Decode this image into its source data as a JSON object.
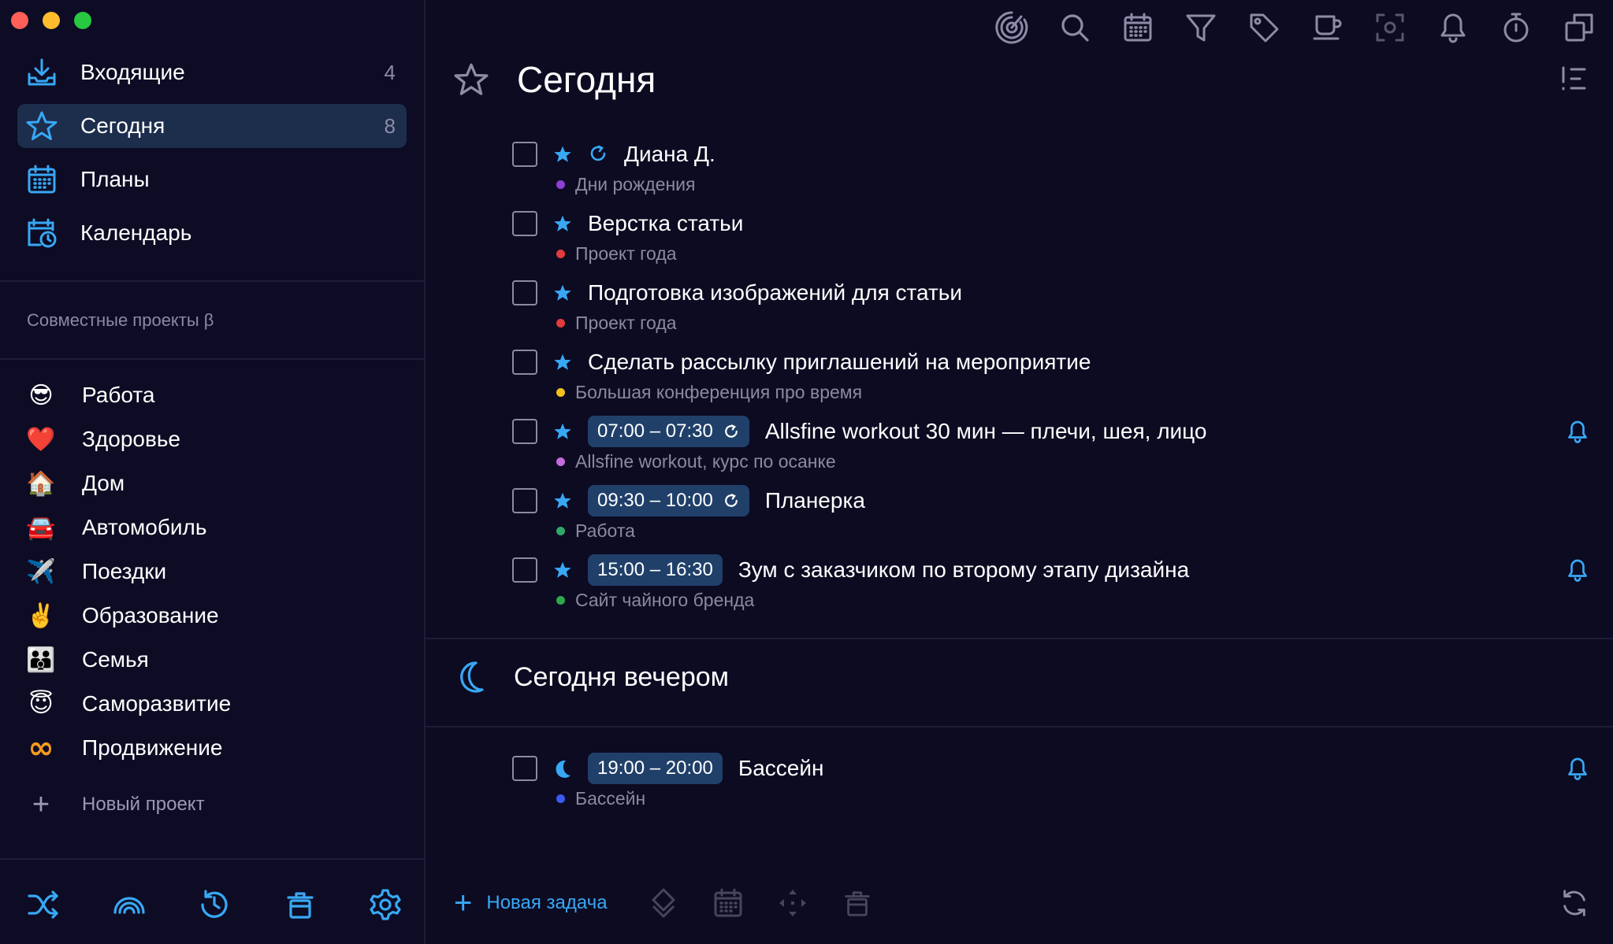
{
  "colors": {
    "accent": "#38a8f5",
    "background": "#0c0b22",
    "active_row": "#1d2d4c",
    "time_badge": "#20406a",
    "muted_text": "#8a8aa2"
  },
  "sidebar": {
    "nav": [
      {
        "label": "Входящие",
        "count": "4",
        "icon": "inbox-icon"
      },
      {
        "label": "Сегодня",
        "count": "8",
        "icon": "star-icon"
      },
      {
        "label": "Планы",
        "count": "",
        "icon": "calendar-grid-icon"
      },
      {
        "label": "Календарь",
        "count": "",
        "icon": "calendar-clock-icon"
      }
    ],
    "shared_title": "Совместные проекты β",
    "projects": [
      {
        "emoji": "😎",
        "label": "Работа"
      },
      {
        "emoji": "❤️",
        "label": "Здоровье"
      },
      {
        "emoji": "🏠",
        "label": "Дом"
      },
      {
        "emoji": "🚘",
        "label": "Автомобиль"
      },
      {
        "emoji": "✈️",
        "label": "Поездки"
      },
      {
        "emoji": "✌️",
        "label": "Образование"
      },
      {
        "emoji": "👪",
        "label": "Семья"
      },
      {
        "emoji": "😇",
        "label": "Саморазвитие"
      },
      {
        "emoji": "∞",
        "label": "Продвижение"
      }
    ],
    "new_project": "Новый проект",
    "bottom_tools": [
      "shuffle-icon",
      "rainbow-icon",
      "history-icon",
      "trash-icon",
      "settings-icon"
    ]
  },
  "toolbar": [
    "focus-icon",
    "search-icon",
    "calendar-icon",
    "filter-icon",
    "tag-icon",
    "coffee-icon",
    "screenshot-icon",
    "bell-icon",
    "timer-icon",
    "windows-icon"
  ],
  "main": {
    "title": "Сегодня",
    "tasks": [
      {
        "title": "Диана Д.",
        "time": "",
        "recurring": true,
        "recurring_in_badge": false,
        "project": "Дни рождения",
        "dot": "#8e3fd6",
        "bell": false
      },
      {
        "title": "Верстка статьи",
        "time": "",
        "recurring": false,
        "recurring_in_badge": false,
        "project": "Проект года",
        "dot": "#e23b3b",
        "bell": false
      },
      {
        "title": "Подготовка изображений для статьи",
        "time": "",
        "recurring": false,
        "recurring_in_badge": false,
        "project": "Проект года",
        "dot": "#e23b3b",
        "bell": false
      },
      {
        "title": "Сделать рассылку приглашений на мероприятие",
        "time": "",
        "recurring": false,
        "recurring_in_badge": false,
        "project": "Большая конференция про время",
        "dot": "#f2c21b",
        "bell": false
      },
      {
        "title": "Allsfine workout 30 мин — плечи, шея, лицо",
        "time": "07:00 – 07:30",
        "recurring": false,
        "recurring_in_badge": true,
        "project": "Allsfine workout, курс по осанке",
        "dot": "#c46adc",
        "bell": true
      },
      {
        "title": "Планерка",
        "time": "09:30 – 10:00",
        "recurring": false,
        "recurring_in_badge": true,
        "project": "Работа",
        "dot": "#2fa86a",
        "bell": false
      },
      {
        "title": "Зум с заказчиком по второму этапу дизайна",
        "time": "15:00 – 16:30",
        "recurring": false,
        "recurring_in_badge": false,
        "project": "Сайт чайного бренда",
        "dot": "#2fa84a",
        "bell": true
      }
    ],
    "evening": {
      "title": "Сегодня вечером",
      "tasks": [
        {
          "title": "Бассейн",
          "time": "19:00 – 20:00",
          "project": "Бассейн",
          "dot": "#3b5bf0",
          "bell": true
        }
      ]
    },
    "new_task": "Новая задача",
    "bottom_tools": [
      "priority-icon",
      "calendar-icon",
      "move-icon",
      "trash-icon"
    ]
  }
}
